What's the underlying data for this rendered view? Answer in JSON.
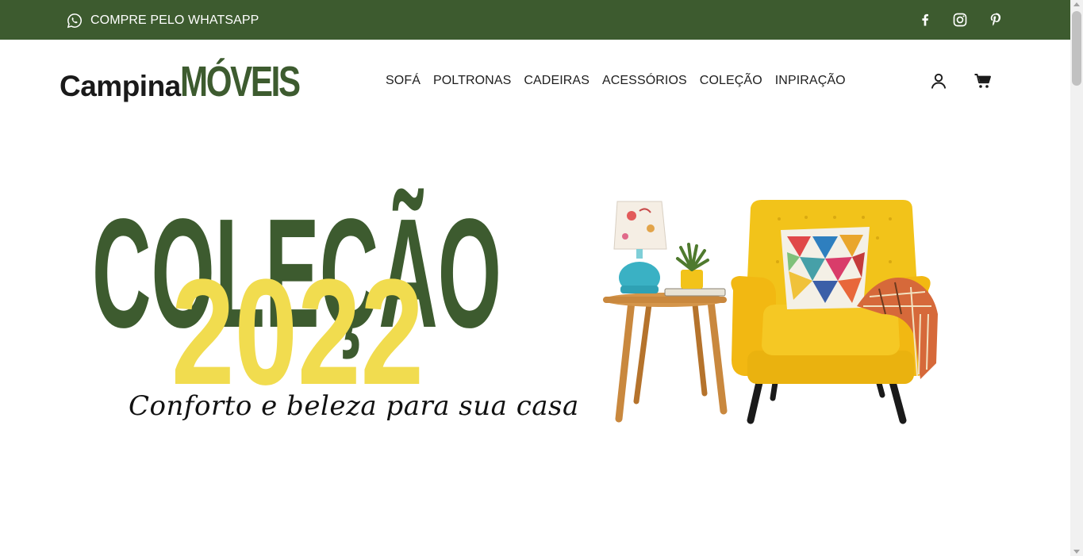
{
  "colors": {
    "brand_green": "#3d5b2f",
    "brand_yellow": "#f1dc4f",
    "text_dark": "#1e1e1e",
    "armchair_yellow": "#f2c31a"
  },
  "topbar": {
    "whatsapp_label": "COMPRE PELO WHATSAPP",
    "whatsapp_icon": "whatsapp-icon",
    "social_icons": [
      "facebook-icon",
      "instagram-icon",
      "pinterest-icon"
    ]
  },
  "header": {
    "logo": {
      "part1": "Campina",
      "part2": "MÓVEIS"
    },
    "nav": [
      "SOFÁ",
      "POLTRONAS",
      "CADEIRAS",
      "ACESSÓRIOS",
      "COLEÇÃO",
      "INPIRAÇÃO"
    ],
    "icons": [
      "user-icon",
      "cart-icon"
    ]
  },
  "hero": {
    "title": "COLEÇÃO",
    "year": "2022",
    "tagline": "Conforto e beleza para sua casa"
  }
}
